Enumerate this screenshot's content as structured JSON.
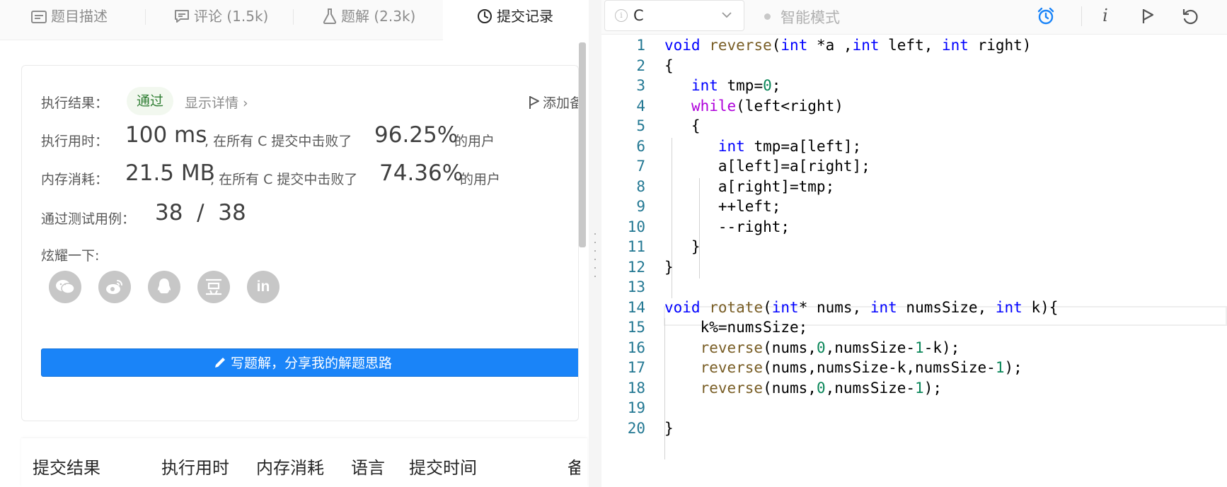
{
  "left": {
    "tabs": [
      {
        "label": "题目描述",
        "icon": "description-icon"
      },
      {
        "label": "评论 (1.5k)",
        "icon": "comment-icon"
      },
      {
        "label": "题解 (2.3k)",
        "icon": "flask-icon"
      },
      {
        "label": "提交记录",
        "icon": "clock-icon",
        "active": true
      }
    ],
    "result": {
      "label": "执行结果：",
      "status": "通过",
      "detail_link": "显示详情 ›",
      "add_note": "添加备"
    },
    "runtime": {
      "label": "执行用时：",
      "value": "100 ms",
      "mid_text": ", 在所有 C 提交中击败了",
      "percent": "96.25%",
      "suffix": "的用户"
    },
    "memory": {
      "label": "内存消耗：",
      "value": "21.5 MB",
      "mid_text": ", 在所有 C 提交中击败了",
      "percent": "74.36%",
      "suffix": "的用户"
    },
    "testcases": {
      "label": "通过测试用例：",
      "value": "38  /  38"
    },
    "share": {
      "label": "炫耀一下:",
      "icons": [
        "wechat-icon",
        "weibo-icon",
        "qq-icon",
        "douban-icon",
        "linkedin-icon"
      ]
    },
    "write_button": "写题解，分享我的解题思路",
    "table_headers": [
      "提交结果",
      "执行用时",
      "内存消耗",
      "语言",
      "提交时间",
      "备"
    ]
  },
  "right": {
    "language": "C",
    "smart_mode": "智能模式",
    "toolbar_icons": [
      "alarm-clock-icon",
      "info-icon",
      "run-flag-icon",
      "reset-icon"
    ],
    "accent_color": "#1a84f8",
    "code_lines": [
      "void reverse(int *a ,int left, int right)",
      "{",
      "   int tmp=0;",
      "   while(left<right)",
      "   {",
      "      int tmp=a[left];",
      "      a[left]=a[right];",
      "      a[right]=tmp;",
      "      ++left;",
      "      --right;",
      "   }",
      "}",
      "",
      "void rotate(int* nums, int numsSize, int k){",
      "    k%=numsSize;",
      "    reverse(nums,0,numsSize-1-k);",
      "    reverse(nums,numsSize-k,numsSize-1);",
      "    reverse(nums,0,numsSize-1);",
      "",
      "}"
    ],
    "line_numbers": [
      "1",
      "2",
      "3",
      "4",
      "5",
      "6",
      "7",
      "8",
      "9",
      "10",
      "11",
      "12",
      "13",
      "14",
      "15",
      "16",
      "17",
      "18",
      "19",
      "20"
    ]
  }
}
